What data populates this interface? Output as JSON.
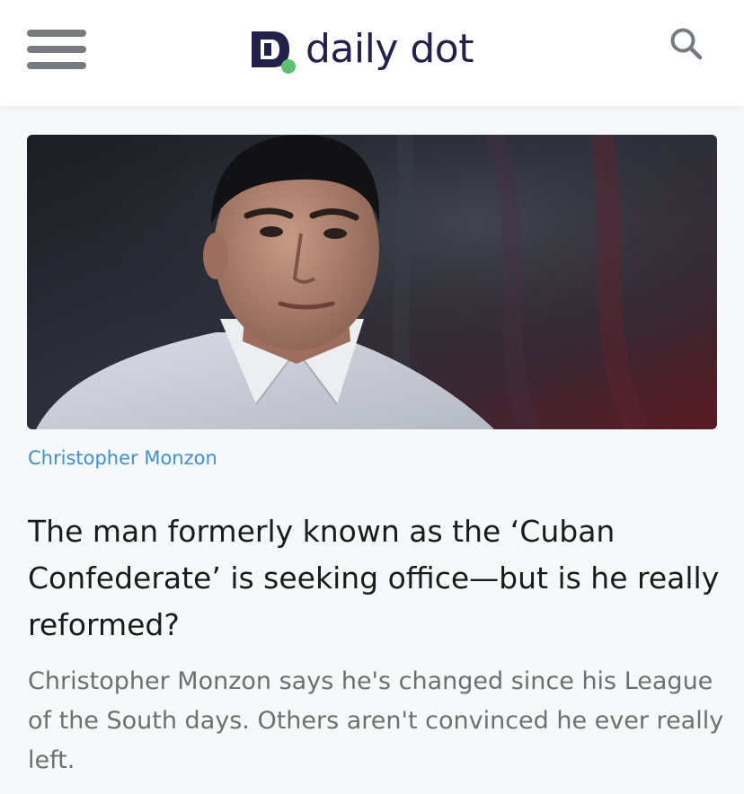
{
  "header": {
    "menu_icon": "hamburger-menu-icon",
    "logo_text": "daily dot",
    "logo_mark_letter": "D",
    "search_icon": "search-icon",
    "colors": {
      "logo_navy": "#23214a",
      "logo_green": "#5fbf73",
      "menu_gray": "#777b80"
    }
  },
  "article": {
    "image_subject": "portrait-photo",
    "photo_credit": "Christopher Monzon",
    "headline": "The man formerly known as the ‘Cuban Confederate’ is seeking office—but is he really reformed?",
    "dek": "Christopher Monzon says he's changed since his League of the South days. Others aren't convinced he ever really left.",
    "colors": {
      "credit_blue": "#3d8fd6",
      "headline": "#1b1b1e",
      "dek": "#6e6f72"
    }
  }
}
